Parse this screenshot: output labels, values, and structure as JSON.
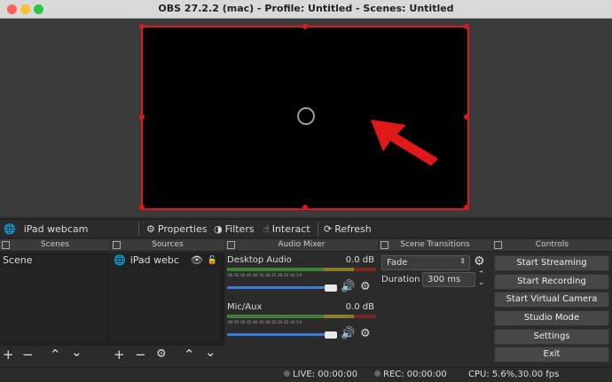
{
  "window": {
    "title": "OBS 27.2.2 (mac) - Profile: Untitled - Scenes: Untitled"
  },
  "source_toolbar": {
    "source_name": "iPad webcam",
    "properties": "Properties",
    "filters": "Filters",
    "interact": "Interact",
    "refresh": "Refresh"
  },
  "docks": {
    "scenes": {
      "title": "Scenes",
      "items": [
        "Scene"
      ]
    },
    "sources": {
      "title": "Sources",
      "items": [
        "iPad webc"
      ]
    },
    "mixer": {
      "title": "Audio Mixer",
      "channels": [
        {
          "name": "Desktop Audio",
          "level": "0.0 dB",
          "volume": 1.0
        },
        {
          "name": "Mic/Aux",
          "level": "0.0 dB",
          "volume": 1.0
        }
      ],
      "ticks": "-60 -55 -50 -45 -40 -35 -30 -25 -20 -15 -10 -5 0"
    },
    "transitions": {
      "title": "Scene Transitions",
      "selected": "Fade",
      "duration_label": "Duration",
      "duration_value": "300 ms"
    },
    "controls": {
      "title": "Controls",
      "buttons": [
        "Start Streaming",
        "Start Recording",
        "Start Virtual Camera",
        "Studio Mode",
        "Settings",
        "Exit"
      ]
    }
  },
  "status": {
    "live": "LIVE: 00:00:00",
    "rec": "REC: 00:00:00",
    "cpu": "CPU: 5.6%,30.00 fps"
  },
  "colors": {
    "selection": "#e01818",
    "arrow": "#e01818",
    "slider": "#3d7ad6"
  }
}
